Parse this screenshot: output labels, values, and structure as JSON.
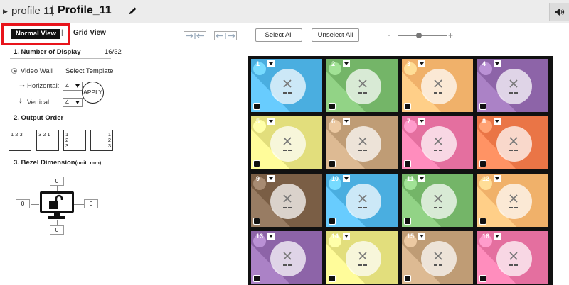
{
  "titlebar": {
    "profile_label": "profile 11",
    "separator": "|",
    "profile_name": "Profile_11"
  },
  "view_tabs": {
    "normal": "Normal View",
    "separator": "|",
    "grid": "Grid View"
  },
  "sections": {
    "number_of_display": "1.  Number of Display",
    "display_count": "16/32",
    "output_order": "2.   Output Order",
    "bezel_dimension": "3.  Bezel Dimension",
    "bezel_unit": "(unit: mm)"
  },
  "video_wall": {
    "label": "Video Wall",
    "select_template": "Select Template",
    "horizontal_label": "Horizontal:",
    "horizontal_value": "4",
    "vertical_label": "Vertical:",
    "vertical_value": "4",
    "apply": "APPLY"
  },
  "output_order": [
    {
      "text": "1 2 3"
    },
    {
      "text": "3 2 1"
    },
    {
      "text": "1\n2\n3"
    },
    {
      "text": "1\n2\n3"
    }
  ],
  "bezel": {
    "top": "0",
    "left": "0",
    "right": "0",
    "bottom": "0"
  },
  "toolbar": {
    "select_all": "Select All",
    "unselect_all": "Unselect All",
    "zoom_minus": "-",
    "zoom_plus": "+"
  },
  "displays": [
    {
      "number": "1",
      "color": "#4aaee0"
    },
    {
      "number": "2",
      "color": "#74b568"
    },
    {
      "number": "3",
      "color": "#f0b16a"
    },
    {
      "number": "4",
      "color": "#8d64a8"
    },
    {
      "number": "5",
      "color": "#e2de7c"
    },
    {
      "number": "6",
      "color": "#bf9c75"
    },
    {
      "number": "7",
      "color": "#e46f9f"
    },
    {
      "number": "8",
      "color": "#ea7546"
    },
    {
      "number": "9",
      "color": "#7a5e45"
    },
    {
      "number": "10",
      "color": "#4aaee0"
    },
    {
      "number": "11",
      "color": "#74b568"
    },
    {
      "number": "12",
      "color": "#f0b16a"
    },
    {
      "number": "13",
      "color": "#8d64a8"
    },
    {
      "number": "14",
      "color": "#e2de7c"
    },
    {
      "number": "15",
      "color": "#bf9c75"
    },
    {
      "number": "16",
      "color": "#e46f9f"
    }
  ]
}
